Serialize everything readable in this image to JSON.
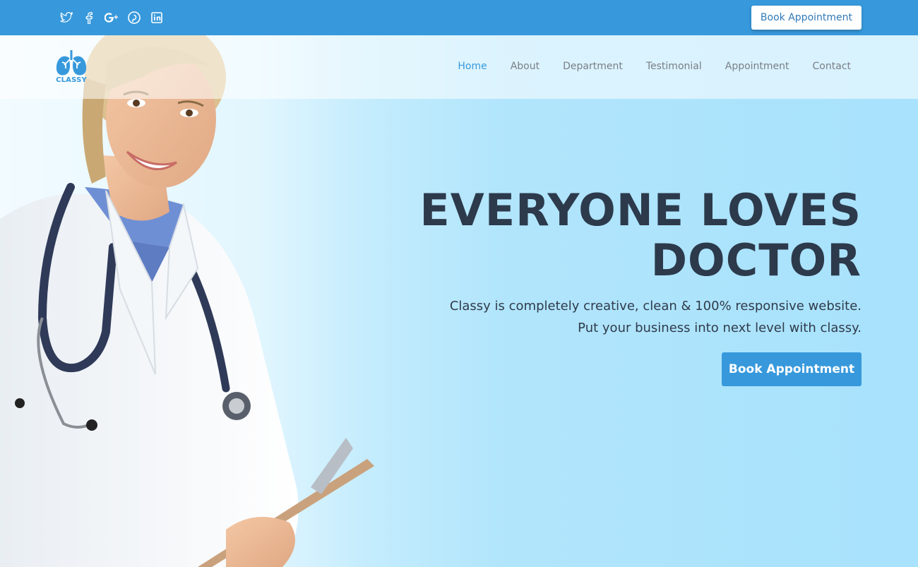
{
  "topbar": {
    "social": [
      {
        "icon": "twitter-icon"
      },
      {
        "icon": "facebook-icon"
      },
      {
        "icon": "google-plus-icon"
      },
      {
        "icon": "pinterest-icon"
      },
      {
        "icon": "linkedin-icon"
      }
    ],
    "book_label": "Book Appointment"
  },
  "logo": {
    "text": "CLASSY",
    "icon": "lungs-icon"
  },
  "nav": {
    "items": [
      "Home",
      "About",
      "Department",
      "Testimonial",
      "Appointment",
      "Contact"
    ],
    "active": "Home"
  },
  "hero": {
    "headline_line1": "EVERYONE LOVES",
    "headline_line2": "DOCTOR",
    "sub_line1": "Classy is completely creative, clean & 100% responsive website.",
    "sub_line2": "Put your business into next level with classy.",
    "button_label": "Book Appointment"
  },
  "colors": {
    "primary": "#3799dc",
    "heading": "#2c3a4c",
    "hero_bg": "#aee4fb"
  }
}
